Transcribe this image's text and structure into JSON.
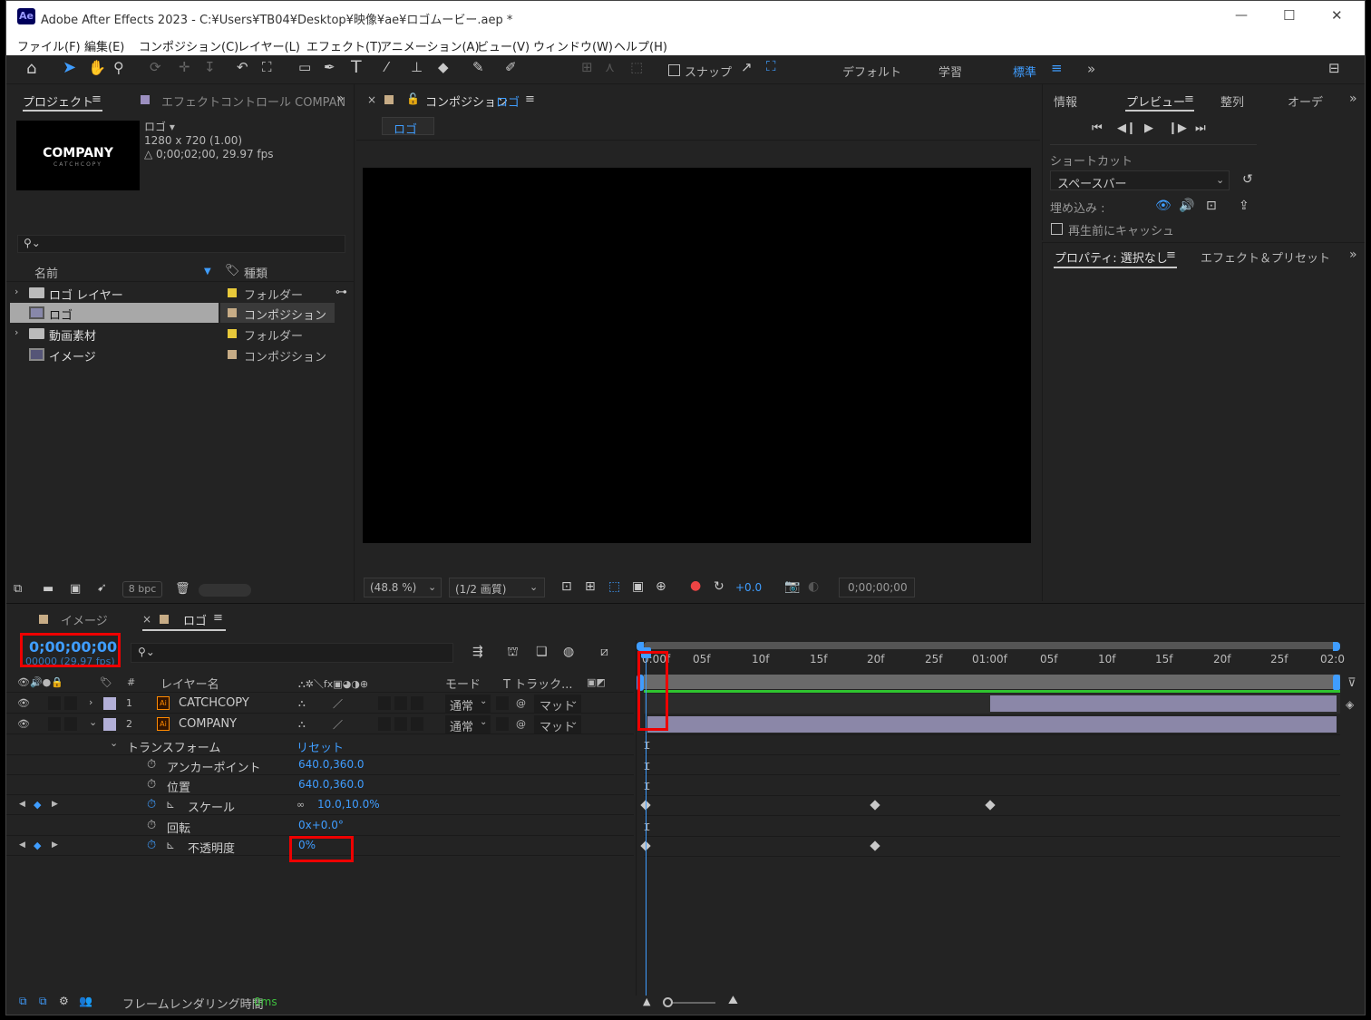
{
  "window": {
    "app_badge": "Ae",
    "title": "Adobe After Effects 2023 - C:¥Users¥TB04¥Desktop¥映像¥ae¥ロゴムービー.aep *",
    "min": "—",
    "max": "☐",
    "close": "✕"
  },
  "menu": [
    "ファイル(F)",
    "編集(E)",
    "コンポジション(C)",
    "レイヤー(L)",
    "エフェクト(T)",
    "アニメーション(A)",
    "ビュー(V)",
    "ウィンドウ(W)",
    "ヘルプ(H)"
  ],
  "toolbar": {
    "snap_label": "スナップ",
    "workspaces": [
      "デフォルト",
      "学習",
      "標準"
    ],
    "more": "»"
  },
  "project": {
    "tab_project": "プロジェクト",
    "tab_effects": "エフェクトコントロール COMPAN",
    "thumb_title": "COMPANY",
    "thumb_sub": "CATCHCOPY",
    "comp_name": "ロゴ ▾",
    "comp_size": "1280 x 720 (1.00)",
    "comp_duration": "△ 0;00;02;00, 29.97 fps",
    "search_placeholder": "",
    "col_name": "名前",
    "col_type": "種類",
    "items": [
      {
        "name": "ロゴ レイヤー",
        "type": "フォルダー",
        "color": "#e8c93a"
      },
      {
        "name": "ロゴ",
        "type": "コンポジション",
        "color": "#c7ac86"
      },
      {
        "name": "動画素材",
        "type": "フォルダー",
        "color": "#e8c93a"
      },
      {
        "name": "イメージ",
        "type": "コンポジション",
        "color": "#c7ac86"
      }
    ],
    "bpc": "8 bpc"
  },
  "comp": {
    "tab_label": "コンポジション",
    "comp_name": "ロゴ",
    "sub_tab": "ロゴ",
    "zoom": "(48.8 %)",
    "resolution": "(1/2 画質)",
    "exposure": "+0.0",
    "timecode": "0;00;00;00"
  },
  "right": {
    "tabs": [
      "情報",
      "プレビュー",
      "整列",
      "オーデ"
    ],
    "shortcut_label": "ショートカット",
    "shortcut_value": "スペースバー",
    "embed_label": "埋め込み :",
    "cache_label": "再生前にキャッシュ",
    "props_tab": "プロパティ: 選択なし",
    "effects_tab": "エフェクト＆プリセット"
  },
  "timeline": {
    "tab_image": "イメージ",
    "tab_logo": "ロゴ",
    "timecode": "0;00;00;00",
    "fps": "00000 (29.97 fps)",
    "col_layer_name": "レイヤー名",
    "col_mode": "モード",
    "col_track": "T  トラック...",
    "ruler": [
      "0:00f",
      "05f",
      "10f",
      "15f",
      "20f",
      "25f",
      "01:00f",
      "05f",
      "10f",
      "15f",
      "20f",
      "25f",
      "02:0"
    ],
    "layers": [
      {
        "num": "1",
        "name": "CATCHCOPY",
        "mode": "通常",
        "matte": "マット"
      },
      {
        "num": "2",
        "name": "COMPANY",
        "mode": "通常",
        "matte": "マット"
      }
    ],
    "transform": "トランスフォーム",
    "reset": "リセット",
    "props": [
      {
        "name": "アンカーポイント",
        "value": "640.0,360.0"
      },
      {
        "name": "位置",
        "value": "640.0,360.0"
      },
      {
        "name": "スケール",
        "value": "10.0,10.0%"
      },
      {
        "name": "回転",
        "value": "0x+0.0°"
      },
      {
        "name": "不透明度",
        "value": "0%"
      }
    ],
    "footer_label": "フレームレンダリング時間",
    "footer_value": "0ms"
  }
}
